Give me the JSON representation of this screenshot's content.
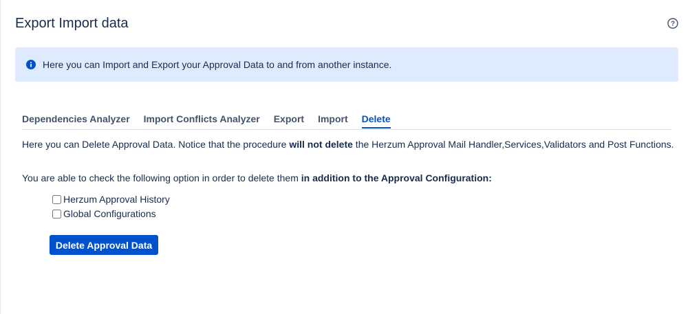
{
  "page": {
    "title": "Export Import data"
  },
  "info": {
    "text": "Here you can Import and Export your Approval Data to and from another instance."
  },
  "tabs": [
    {
      "label": "Dependencies Analyzer"
    },
    {
      "label": "Import Conflicts Analyzer"
    },
    {
      "label": "Export"
    },
    {
      "label": "Import"
    },
    {
      "label": "Delete"
    }
  ],
  "active_tab": "Delete",
  "delete_panel": {
    "notice_prefix": "Here you can Delete Approval Data. Notice that the procedure ",
    "notice_bold": "will not delete",
    "notice_suffix": " the Herzum Approval Mail Handler,Services,Validators and Post Functions.",
    "option_prefix": "You are able to check the following option in order to delete them ",
    "option_bold": "in addition to the Approval Configuration:",
    "options": [
      {
        "label": "Herzum Approval History",
        "checked": false
      },
      {
        "label": "Global Configurations",
        "checked": false
      }
    ],
    "button_label": "Delete Approval Data"
  },
  "colors": {
    "accent": "#0052cc",
    "info_bg": "#deebff",
    "text": "#172b4d"
  }
}
